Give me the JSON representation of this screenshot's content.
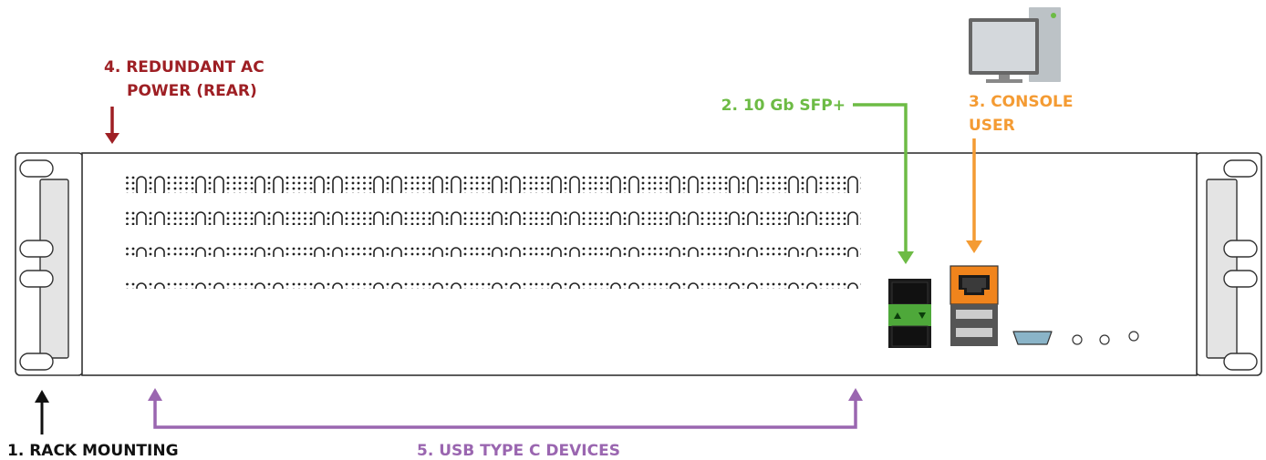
{
  "labels": {
    "rack_mounting": "1. RACK MOUNTING",
    "sfp_line1": "2. 10 Gb SFP+",
    "console_line1": "3. CONSOLE",
    "console_line2": "USER",
    "power_line1": "4. REDUNDANT AC",
    "power_line2": "POWER (REAR)",
    "usb": "5. USB TYPE C DEVICES"
  },
  "colors": {
    "rack_mounting": "#111111",
    "sfp": "#6dbb45",
    "console": "#f49b33",
    "power": "#9e1f24",
    "usb": "#9a66b0",
    "chassis_stroke": "#333333",
    "ear_fill": "#e4e4e4",
    "sfp_module": "#4ea83a",
    "rj45_orange": "#f0841c",
    "serial_port": "#8ab4c8",
    "monitor": "#d4d8dc",
    "tower": "#bcc2c6",
    "tower_led": "#6dbb45"
  },
  "icons": {
    "computer": "desktop-computer-icon",
    "sfp_port": "sfp-port-icon",
    "rj45_port": "ethernet-port-icon",
    "usb_ports": "usb-port-icon",
    "serial_port": "serial-port-icon",
    "indicator_leds": "led-indicator-icon"
  }
}
